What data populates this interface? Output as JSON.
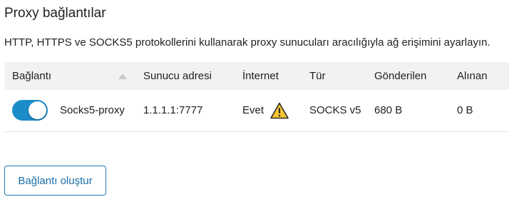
{
  "page": {
    "title": "Proxy bağlantılar",
    "description": "HTTP, HTTPS ve SOCKS5 protokollerini kullanarak proxy sunucuları aracılığıyla ağ erişimini ayarlayın."
  },
  "table": {
    "columns": [
      "Bağlantı",
      "Sunucu adresi",
      "İnternet",
      "Tür",
      "Gönderilen",
      "Alınan"
    ],
    "sort_icon": "sort-up-icon",
    "rows": [
      {
        "enabled": true,
        "name": "Socks5-proxy",
        "server": "1.1.1.1:7777",
        "internet": "Evet",
        "internet_status_icon": "warning-icon",
        "type": "SOCKS v5",
        "sent": "680 B",
        "received": "0 B"
      }
    ]
  },
  "actions": {
    "create_label": "Bağlantı oluştur"
  },
  "colors": {
    "accent": "#1b8cc8",
    "warning": "#f5c531",
    "header_bg": "#f2f2f2"
  }
}
